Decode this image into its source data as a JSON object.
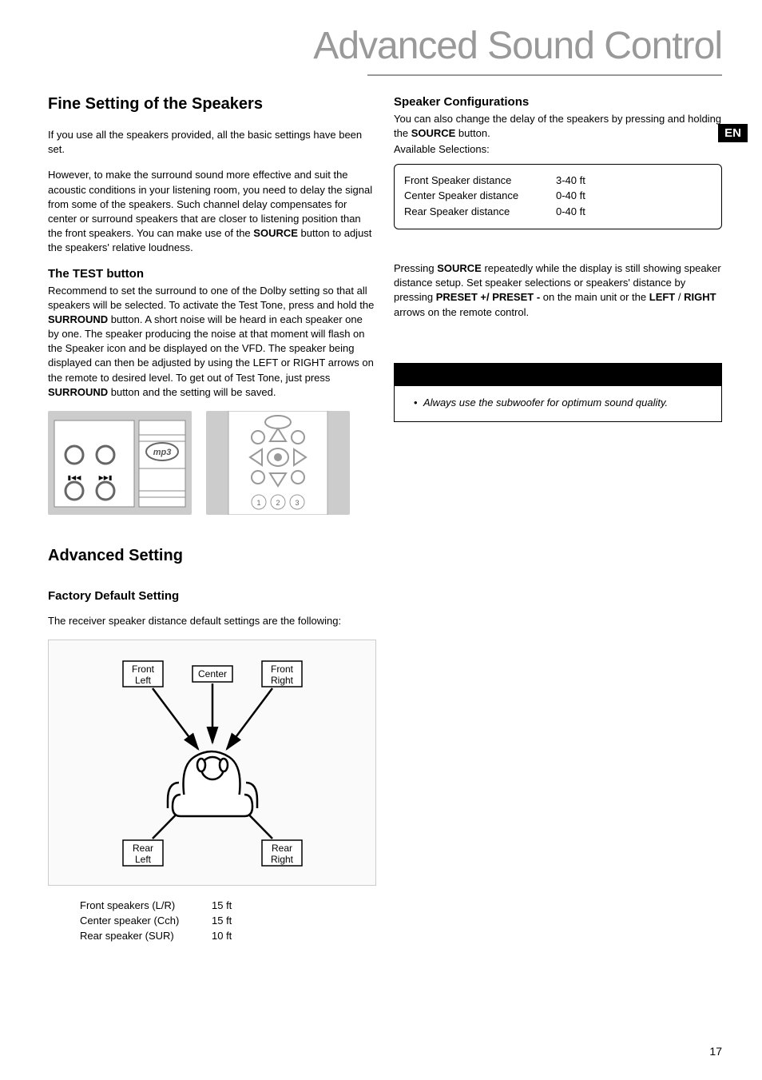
{
  "page": {
    "title": "Advanced Sound Control",
    "lang_tab": "EN",
    "number": "17"
  },
  "left": {
    "h_fine": "Fine Setting of the Speakers",
    "p_fine_1": "If you use all the speakers provided, all the basic settings have been set.",
    "p_fine_2a": "However, to make the surround sound more effective and suit the acoustic conditions in your listening room, you need to delay the signal from some of the speakers. Such channel delay  compensates for center or surround speakers that are closer to listening position than the front speakers. You can make use of the ",
    "p_fine_2_btn": "SOURCE",
    "p_fine_2b": " button to adjust the speakers' relative loudness.",
    "h_test": "The TEST button",
    "p_test_a": "Recommend to set the surround to one of the Dolby setting so that all speakers will be selected.  To activate the Test Tone, press and hold the ",
    "p_test_btn1": "SURROUND",
    "p_test_b": " button.  A short noise will be heard in each speaker one by one.  The speaker producing the noise at that moment will flash on the Speaker icon and be displayed on the VFD. The speaker being displayed can then be adjusted by using the LEFT or RIGHT arrows on the remote to desired level.  To get out of Test Tone, just press ",
    "p_test_btn2": "SURROUND",
    "p_test_c": " button and the setting will be saved.",
    "h_adv": "Advanced Setting",
    "h_factory": "Factory Default Setting",
    "p_factory": "The receiver speaker distance default settings are the following:",
    "diag_labels": {
      "fl1": "Front",
      "fl2": "Left",
      "c": "Center",
      "fr1": "Front",
      "fr2": "Right",
      "rl1": "Rear",
      "rl2": "Left",
      "rr1": "Rear",
      "rr2": "Right"
    },
    "defaults": [
      {
        "k": "Front speakers (L/R)",
        "v": "15 ft"
      },
      {
        "k": "Center speaker (Cch)",
        "v": "15 ft"
      },
      {
        "k": "Rear speaker (SUR)",
        "v": "10 ft"
      }
    ],
    "panel_mp3": "mp3"
  },
  "right": {
    "h_spk": "Speaker Configurations",
    "p_spk_a": "You can also change the delay of the speakers by pressing and holding the ",
    "p_spk_btn": "SOURCE",
    "p_spk_b": " button.",
    "p_avail": "Available Selections:",
    "config": [
      {
        "k": "Front Speaker distance",
        "v": "3-40 ft"
      },
      {
        "k": "Center Speaker distance",
        "v": "0-40 ft"
      },
      {
        "k": "Rear Speaker distance",
        "v": "0-40 ft"
      }
    ],
    "p_press_a": "Pressing ",
    "p_press_b1": "SOURCE",
    "p_press_c": " repeatedly while the display is still showing  speaker distance setup. Set speaker selections or speakers' distance  by pressing ",
    "p_press_b2": "PRESET +/ PRESET -",
    "p_press_d": " on the main unit or the ",
    "p_press_b3": "LEFT",
    "p_press_e": " / ",
    "p_press_b4": "RIGHT",
    "p_press_f": " arrows on the remote control.",
    "note": "Always use the subwoofer for optimum sound quality."
  }
}
